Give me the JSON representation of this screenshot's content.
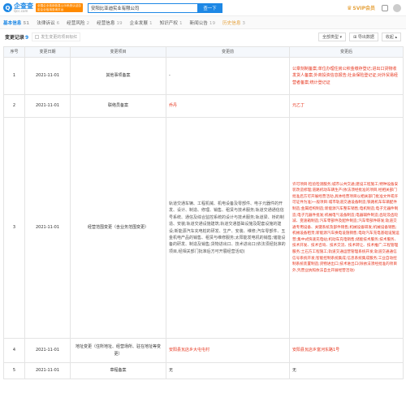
{
  "header": {
    "logo_text": "企查查",
    "logo_sub": "Qcc.com",
    "badge_text": "全国企业信用信息公示系统认证自定企业信用查询平台",
    "search_value": "安阳比亚迪实业有限公司",
    "search_button": "查一下",
    "vip_label": "SVIP会员",
    "notify_label": "消息"
  },
  "nav": {
    "items": [
      {
        "label": "基本信息",
        "count": "51"
      },
      {
        "label": "法律诉讼",
        "count": "6"
      },
      {
        "label": "经营风险",
        "count": "2"
      },
      {
        "label": "经营信息",
        "count": "19"
      },
      {
        "label": "企业发展",
        "count": "1"
      },
      {
        "label": "知识产权",
        "count": "1"
      },
      {
        "label": "新闻公告",
        "count": "19"
      },
      {
        "label": "历史信息",
        "count": "3"
      }
    ]
  },
  "subheader": {
    "title": "变更记录",
    "count": "9",
    "checkbox_label": "发生变更的项目标红",
    "select_label": "全部类型",
    "export_label": "导出数据",
    "toggle_label": "收起"
  },
  "table": {
    "headers": [
      "序号",
      "变更日期",
      "变更项目",
      "变更前",
      "变更后"
    ],
    "rows": [
      {
        "no": "1",
        "date": "2021-11-01",
        "item": "其他事项备案",
        "before": "-",
        "after": "公章刻制备案;单位办理住房公积金缴存登记;进出口货物收发货人备案;外商投资信息报告;社会保险登记证;对外贸易经营者备案;统计登记证"
      },
      {
        "no": "2",
        "date": "2021-11-01",
        "item": "联络员备案",
        "before": "乔丹",
        "after": "元乙丁"
      },
      {
        "no": "3",
        "date": "2021-11-01",
        "item": "经营范围变更（含业务范围变更）",
        "before": "轨道交通车辆、工程机械、机电设备及零部件、电子元器件的开发、设计、制造、修理、销售、租赁与技术服务;轨道交通通信信号系统、通信及综合监控系统的设计与技术服务;轨道梁、桥的制造、安装;轨道交通设施建筑;轨道交通基础设施及配套设施的建设;新能源汽车充电桩的研发、生产、安装、维修;汽车零部件、五金机电产品的销售、租赁与维修服务;太阳能发电机的销售;储能设备的研发、制造及销售;货物进出口、技术进出口(依法须经批准的项目,经相关部门批准后方可开展经营活动)",
        "after": "许可项目:检验检测服务;城市公共交通;建设工程施工;特种设备安装改造修理;道路机动车辆生产(依法须经批准的项目,经相关部门批准后方可开展经营活动,具体经营项目以相关部门批准文件或许可证件为准)一般项目:城市轨道交通设备制造;铁路机车车辆配件制造;金属结构制造;新能源汽车整车销售;电机制造;电子元器件制造;电子元器件批发;机械电气设备制造;电器辅件制造;齿轮及齿轮减、变速箱制造;汽车零部件及配件制造;汽车零部件研发;轨道交通专用设备、关键系统及部件销售;机械设备研发;机械设备销售;机械设备租赁;新能源汽车换电设施销售;电动汽车充电基础设施运营;集中式快速充电站;机动车充电销售;储能技术服务;技术服务、技术开发、技术咨询、技术交流、技术转让、技术推广;工程管理服务;土石方工程施工;轨道交通运营管理系统开发;轨道交通通信信号系统开发;智能控制系统集成;信息系统集成服务;工业自动控制系统装置制造;货物进出口;技术进出口(除依法须经批准的项目外,凭营业执照依法自主开展经营活动)"
      },
      {
        "no": "4",
        "date": "2021-11-01",
        "item": "地址变更（住所地址、经营场所、驻在地址等变更）",
        "before": "安阳县瓦店乡大屯屯村",
        "after": "安阳县瓦店乡富河东路1号"
      },
      {
        "no": "5",
        "date": "2021-11-01",
        "item": "章程备案",
        "before": "无",
        "after": "无"
      }
    ]
  },
  "colors": {
    "accent": "#1e88e5",
    "change_red": "#e6331b",
    "vip_gold": "#e6a23c"
  }
}
